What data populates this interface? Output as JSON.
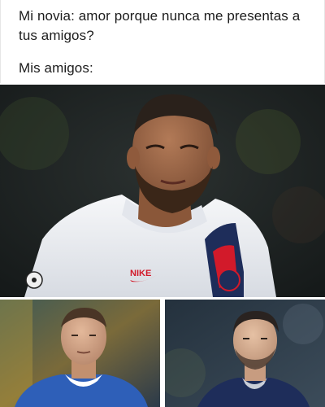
{
  "caption": {
    "line1": "Mi novia: amor porque nunca me presentas a tus amigos?",
    "line2": "Mis amigos:"
  },
  "photos": [
    {
      "position": "top",
      "subject": "player-white-jersey",
      "shirt_text": "NIKE"
    },
    {
      "position": "bottom-left",
      "subject": "player-blue-jersey"
    },
    {
      "position": "bottom-right",
      "subject": "player-navy-jersey"
    }
  ],
  "colors": {
    "text": "#1c1c1c",
    "white_jersey": "#eef0f3",
    "red_trim": "#d21a2a",
    "navy": "#1e2d5a",
    "blue_jersey": "#2e5fb8",
    "background_dark": "#1b2022"
  }
}
